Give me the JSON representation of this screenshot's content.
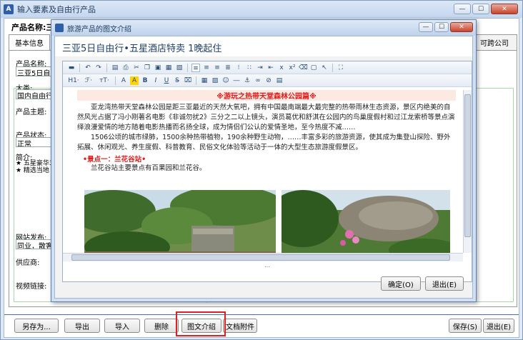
{
  "window": {
    "title": "输入要素及自由行产品",
    "min": "—",
    "max": "☐",
    "close": "✕"
  },
  "product": {
    "name_label": "产品名称:",
    "name_value": "三亚"
  },
  "tabs": [
    {
      "label": "基本信息"
    },
    {
      "label": "可跨公司"
    }
  ],
  "fields": {
    "name_label": "产品名称:",
    "name_value": "三亚5日自由",
    "category_label": "大类:",
    "category_value": "国内自由行",
    "theme_label": "产品主题:",
    "status_label": "产品状态:",
    "status_value": "正常",
    "intro_label": "简介:",
    "intro_line1": "★ 五星豪华3",
    "intro_line2": "★ 精选当地",
    "site_label": "网站发布:",
    "site_value": "同业，散客标",
    "supplier_label": "供应商:",
    "video_label": "视频链接:"
  },
  "bottom_buttons": {
    "save_as": "另存为...",
    "export": "导出",
    "import": "导入",
    "delete": "删除",
    "image_intro": "图文介绍",
    "doc_attach": "文档附件",
    "save": "保存(S)",
    "exit": "退出(E)"
  },
  "dialog": {
    "title": "旅游产品的图文介绍",
    "headline": "三亚5日自由行•五星酒店特卖 1晚起住",
    "toolbar_row2": {
      "h1": "H1·",
      "font": "ℱ·",
      "size": "ᴛT·"
    },
    "content": {
      "heading": "※游玩之热带天堂森林公园篇※",
      "para1": "亚龙湾热带天堂森林公园是距三亚最近的天然大氧吧，拥有中国最南端最大最完整的热带雨林生态资源，景区内绝美的自然风光占据了冯小刚著名电影《非诚勿扰2》三分之二以上镜头，演员葛优和舒淇在公园内的鸟巢度假村和过江龙索桥等景点演绎浪漫爱情的地方随着电影热播而名扬全球，成为情侣们公认的爱情圣地，至今热度不减……",
      "para2": "1506公顷的城市绿肺，1500余种热带植物，190余种野生动物，……丰富多彩的旅游资源，使其成为集登山探险、野外拓展、休闲观光、养生度假、科普教育、民俗文化体验等活动于一体的大型生态旅游度假景区。",
      "spot_title": "•景点一：兰花谷站•",
      "spot_text": "兰花谷站主要景点有百果园和兰花谷。"
    },
    "ok": "确定(O)",
    "exit": "退出(E)"
  }
}
